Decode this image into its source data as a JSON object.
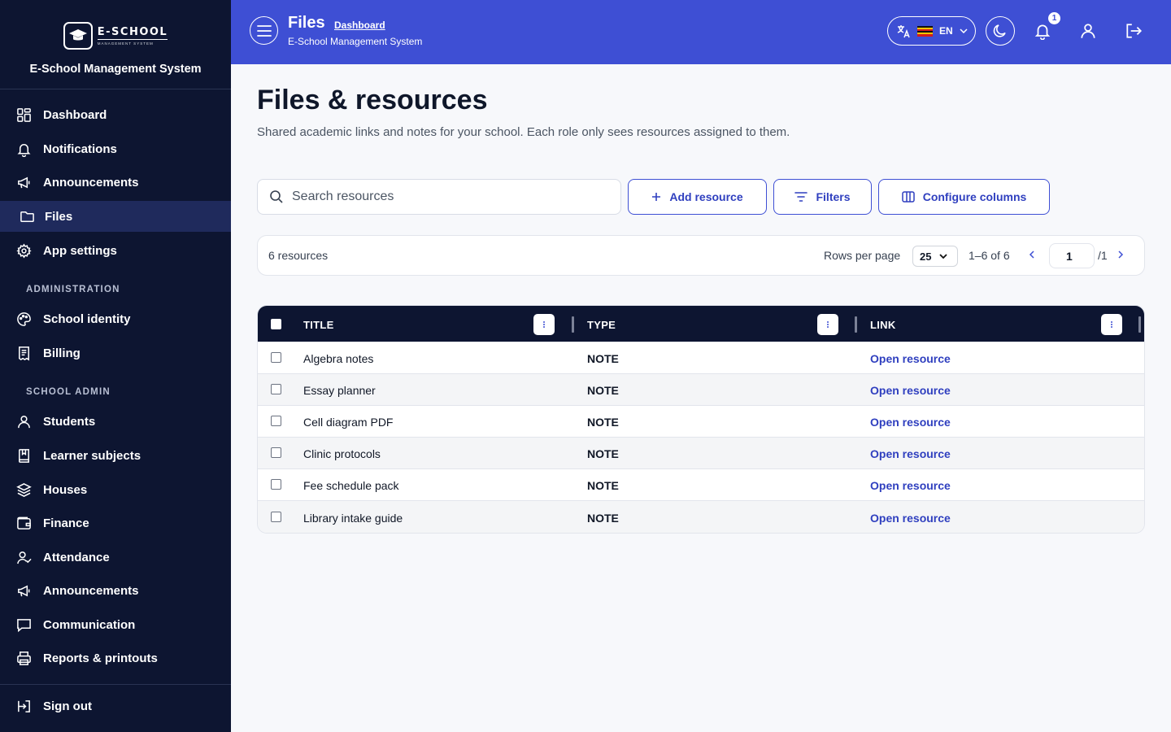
{
  "brand": {
    "logo_main": "E-SCHOOL",
    "logo_sub": "MANAGEMENT SYSTEM",
    "name": "E-School Management System"
  },
  "sidebar": {
    "items": [
      {
        "label": "Dashboard",
        "icon": "dashboard-icon"
      },
      {
        "label": "Notifications",
        "icon": "bell-icon"
      },
      {
        "label": "Announcements",
        "icon": "megaphone-icon"
      },
      {
        "label": "Files",
        "icon": "folder-icon",
        "active": true
      },
      {
        "label": "App settings",
        "icon": "gear-icon"
      }
    ],
    "admin_label": "ADMINISTRATION",
    "admin_items": [
      {
        "label": "School identity",
        "icon": "palette-icon"
      },
      {
        "label": "Billing",
        "icon": "receipt-icon"
      }
    ],
    "school_label": "SCHOOL ADMIN",
    "school_items": [
      {
        "label": "Students",
        "icon": "user-icon"
      },
      {
        "label": "Learner subjects",
        "icon": "book-icon"
      },
      {
        "label": "Houses",
        "icon": "layers-icon"
      },
      {
        "label": "Finance",
        "icon": "wallet-icon"
      },
      {
        "label": "Attendance",
        "icon": "user-check-icon"
      },
      {
        "label": "Announcements",
        "icon": "megaphone-icon"
      },
      {
        "label": "Communication",
        "icon": "message-icon"
      },
      {
        "label": "Reports & printouts",
        "icon": "printer-icon"
      }
    ],
    "sign_out": "Sign out"
  },
  "header": {
    "title": "Files",
    "breadcrumb": "Dashboard",
    "subtitle": "E-School Management System",
    "language": "EN",
    "notification_count": "1",
    "accent": "#3e4fd4"
  },
  "main": {
    "title": "Files & resources",
    "description": "Shared academic links and notes for your school. Each role only sees resources assigned to them.",
    "search_placeholder": "Search resources",
    "add_label": "Add resource",
    "filters_label": "Filters",
    "columns_label": "Configure columns"
  },
  "pager": {
    "count": "6 resources",
    "rows_label": "Rows per page",
    "rows_value": "25",
    "range": "1–6 of 6",
    "page": "1",
    "total": "/1"
  },
  "table": {
    "headers": [
      "TITLE",
      "TYPE",
      "LINK"
    ],
    "rows": [
      {
        "title": "Algebra notes",
        "type": "NOTE",
        "link": "Open resource"
      },
      {
        "title": "Essay planner",
        "type": "NOTE",
        "link": "Open resource"
      },
      {
        "title": "Cell diagram PDF",
        "type": "NOTE",
        "link": "Open resource"
      },
      {
        "title": "Clinic protocols",
        "type": "NOTE",
        "link": "Open resource"
      },
      {
        "title": "Fee schedule pack",
        "type": "NOTE",
        "link": "Open resource"
      },
      {
        "title": "Library intake guide",
        "type": "NOTE",
        "link": "Open resource"
      }
    ]
  }
}
